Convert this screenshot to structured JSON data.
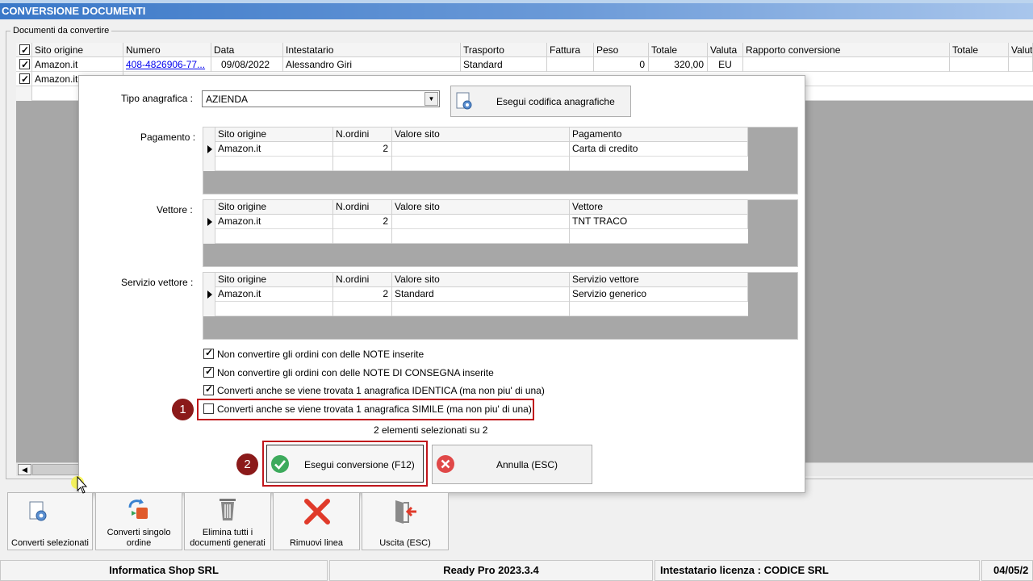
{
  "window": {
    "title": "CONVERSIONE DOCUMENTI"
  },
  "group": {
    "label": "Documenti da convertire"
  },
  "background_grid": {
    "columns": [
      "Sito origine",
      "Numero",
      "Data",
      "Intestatario",
      "Trasporto",
      "Fattura",
      "Peso",
      "Totale",
      "Valuta",
      "Rapporto conversione",
      "Totale",
      "Valut"
    ],
    "rows": [
      {
        "checked": true,
        "sito": "Amazon.it",
        "numero": "408-4826906-77...",
        "data": "09/08/2022",
        "intestatario": "Alessandro Giri",
        "trasporto": "Standard",
        "fattura": "",
        "peso": "0",
        "totale": "320,00",
        "valuta": "EU"
      },
      {
        "checked": true,
        "sito": "Amazon.it"
      }
    ]
  },
  "dialog": {
    "tipo_label": "Tipo anagrafica :",
    "tipo_value": "AZIENDA",
    "codifica_button": "Esegui codifica anagrafiche",
    "pagamento": {
      "label": "Pagamento :",
      "headers": [
        "Sito origine",
        "N.ordini",
        "Valore sito",
        "Pagamento"
      ],
      "row": [
        "Amazon.it",
        "2",
        "",
        "Carta di credito"
      ]
    },
    "vettore": {
      "label": "Vettore :",
      "headers": [
        "Sito origine",
        "N.ordini",
        "Valore sito",
        "Vettore"
      ],
      "row": [
        "Amazon.it",
        "2",
        "",
        "TNT TRACO"
      ]
    },
    "servizio": {
      "label": "Servizio vettore :",
      "headers": [
        "Sito origine",
        "N.ordini",
        "Valore sito",
        "Servizio vettore"
      ],
      "row": [
        "Amazon.it",
        "2",
        "Standard",
        "Servizio generico"
      ]
    },
    "options": [
      {
        "label": "Non convertire gli ordini con delle NOTE inserite",
        "checked": true
      },
      {
        "label": "Non convertire gli ordini con delle NOTE DI CONSEGNA inserite",
        "checked": true
      },
      {
        "label": "Converti anche se viene trovata 1 anagrafica IDENTICA (ma non piu' di una)",
        "checked": true
      },
      {
        "label": "Converti anche se viene trovata 1 anagrafica SIMILE (ma non piu' di una)",
        "checked": false
      }
    ],
    "selection_status": "2 elementi selezionati su 2",
    "execute_button": "Esegui conversione (F12)",
    "cancel_button": "Annulla (ESC)"
  },
  "markers": [
    "1",
    "2"
  ],
  "toolbar": {
    "buttons": [
      {
        "label": "Converti selezionati",
        "icon": "gear-document-icon"
      },
      {
        "label": "Converti singolo ordine",
        "icon": "convert-arrows-icon"
      },
      {
        "label": "Elimina tutti i documenti generati",
        "icon": "trash-icon"
      },
      {
        "label": "Rimuovi linea",
        "icon": "red-x-icon"
      },
      {
        "label": "Uscita (ESC)",
        "icon": "exit-door-icon"
      }
    ]
  },
  "statusbar": {
    "company": "Informatica Shop SRL",
    "version": "Ready Pro 2023.3.4",
    "license": "Intestatario licenza : CODICE SRL",
    "date": "04/05/2"
  },
  "colors": {
    "accent_red": "#c0161c",
    "marker": "#8b1a1a",
    "title_blue": "#3a78c8"
  }
}
